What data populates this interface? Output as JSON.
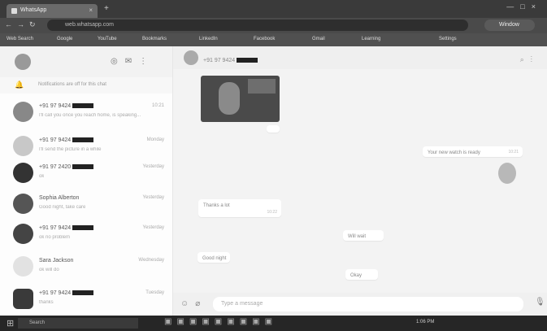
{
  "browser": {
    "tab_title": "WhatsApp",
    "url": "web.whatsapp.com",
    "profile_label": "Window",
    "bookmarks": [
      "Web Search",
      "Google",
      "YouTube",
      "Bookmarks",
      "LinkedIn",
      "Facebook",
      "Gmail",
      "Learning",
      "Settings"
    ]
  },
  "sidebar": {
    "notice": "Notifications are off for this chat",
    "chats": [
      {
        "name": "+91 97 9424",
        "time": "10:21",
        "preview": "I'll call you once you reach home, is speaking..."
      },
      {
        "name": "+91 97 9424",
        "time": "Monday",
        "preview": "I'll send the picture in a while"
      },
      {
        "name": "+91 97 2420",
        "time": "Yesterday",
        "preview": "ok"
      },
      {
        "name": "Sophia Alberton",
        "time": "Yesterday",
        "preview": "Good night, take care"
      },
      {
        "name": "+91 97 9424",
        "time": "Yesterday",
        "preview": "ok no problem"
      },
      {
        "name": "Sara Jackson",
        "time": "Wednesday",
        "preview": "ok will do"
      },
      {
        "name": "+91 97 9424",
        "time": "Tuesday",
        "preview": "thanks"
      }
    ]
  },
  "conversation": {
    "contact_name": "+91 97 9424",
    "messages": [
      {
        "text": "Your new watch is ready",
        "time": "10:21"
      },
      {
        "text": "Thanks a lot",
        "time": "10:22"
      },
      {
        "text": "Will wait",
        "time": "10:22"
      },
      {
        "text": "Good night",
        "time": "10:30"
      },
      {
        "text": "Okay",
        "time": "10:31"
      }
    ],
    "composer_placeholder": "Type a message"
  },
  "taskbar": {
    "search_placeholder": "Search",
    "tray_time": "1:06 PM"
  },
  "icons": [
    "menu-icon",
    "search-icon",
    "attach-icon",
    "emoji-icon",
    "mic-icon",
    "status-icon",
    "chat-icon",
    "more-icon"
  ]
}
